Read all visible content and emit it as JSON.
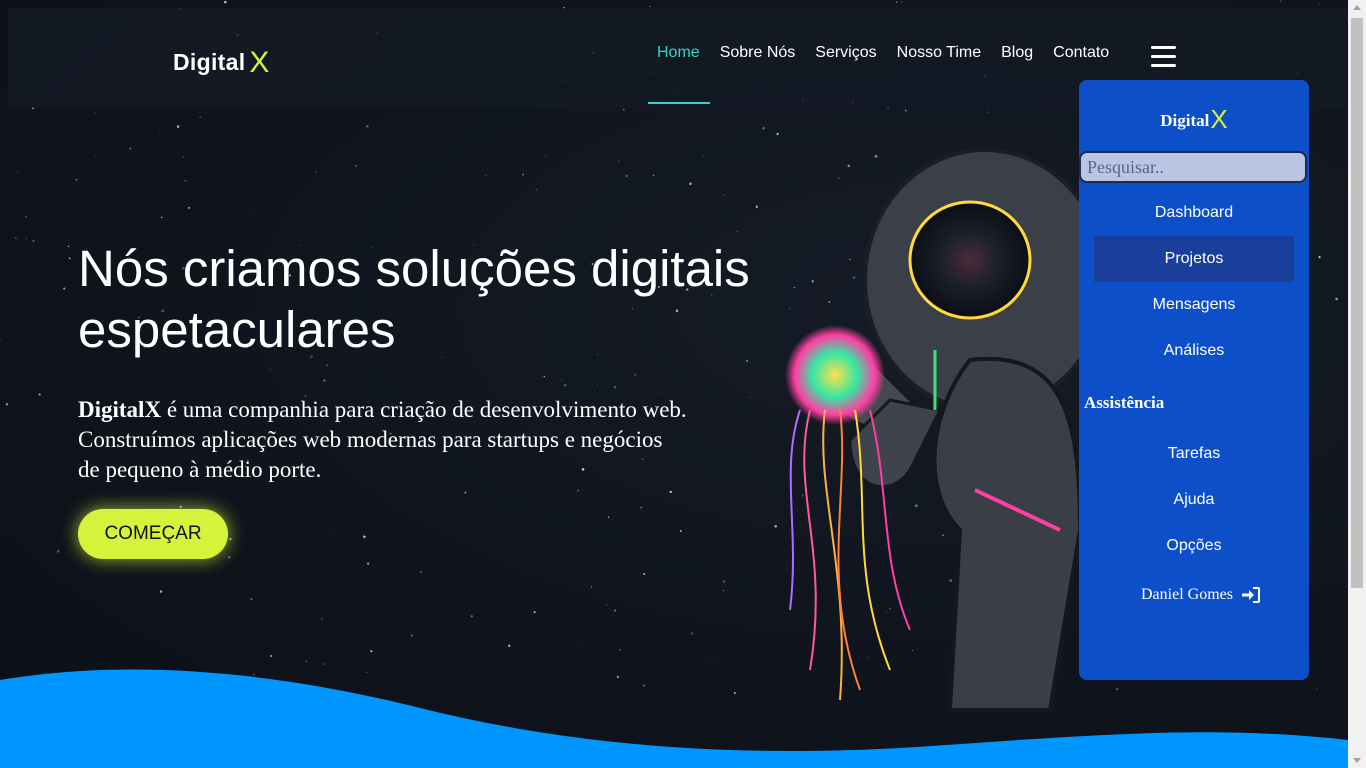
{
  "header": {
    "logo_text": "Digital",
    "logo_mark": "X",
    "nav": [
      {
        "label": "Home",
        "active": true
      },
      {
        "label": "Sobre Nós"
      },
      {
        "label": "Serviços"
      },
      {
        "label": "Nosso Time"
      },
      {
        "label": "Blog"
      },
      {
        "label": "Contato"
      }
    ],
    "menu_icon": "hamburger-icon"
  },
  "hero": {
    "title": "Nós criamos soluções digitais espetaculares",
    "brand": "DigitalX",
    "text_1": " é uma companhia para criação de desenvolvimento web.",
    "text_2": "Construímos aplicações web modernas para startups e negócios",
    "text_3": "de pequeno à médio porte.",
    "cta_label": "COMEÇAR"
  },
  "sidebar": {
    "logo_text": "Digital",
    "logo_mark": "X",
    "search_placeholder": "Pesquisar..",
    "items": [
      {
        "label": "Dashboard"
      },
      {
        "label": "Projetos",
        "selected": true
      },
      {
        "label": "Mensagens"
      },
      {
        "label": "Análises"
      }
    ],
    "section_label": "Assistência",
    "assist_items": [
      {
        "label": "Tarefas"
      },
      {
        "label": "Ajuda"
      },
      {
        "label": "Opções"
      }
    ],
    "user_name": "Daniel Gomes",
    "user_icon": "sign-in-icon"
  },
  "colors": {
    "accent": "#d6f23a",
    "nav_active": "#34d3c8",
    "panel": "#0d4fc9",
    "wave": "#0096ff"
  }
}
